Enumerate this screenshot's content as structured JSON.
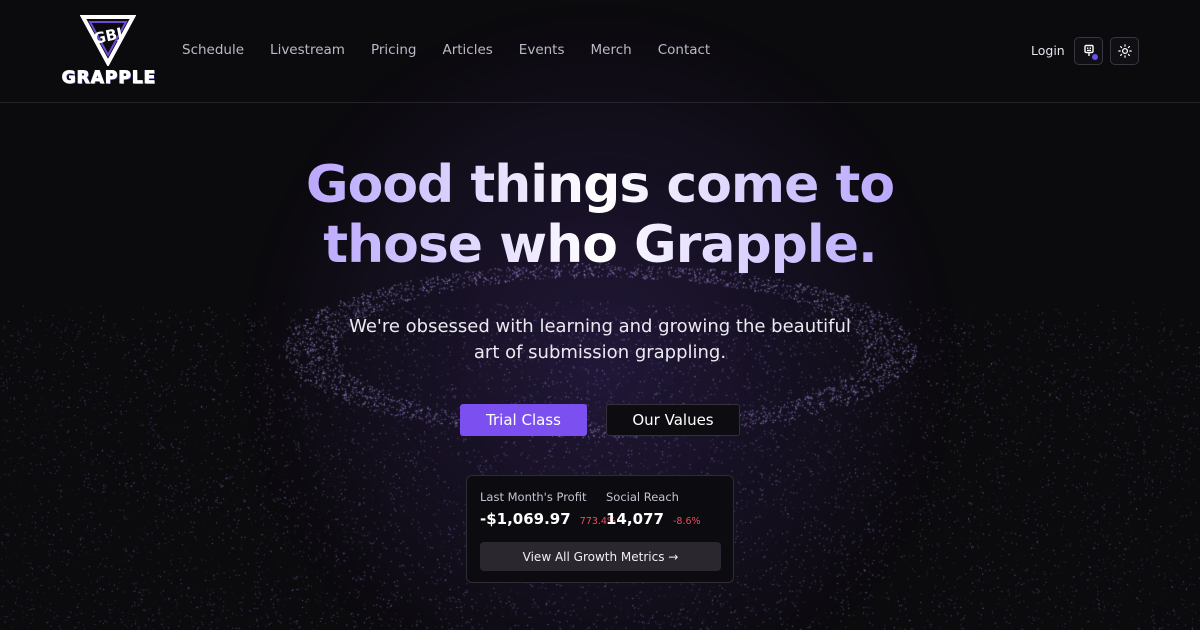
{
  "brand": {
    "logo_text": "GRAPPLE",
    "logo_mark": "triangle-gbj-icon",
    "accent": "#7c4ff0"
  },
  "nav": {
    "items": [
      "Schedule",
      "Livestream",
      "Pricing",
      "Articles",
      "Events",
      "Merch",
      "Contact"
    ],
    "login": "Login",
    "icons": [
      "keyboard-icon",
      "sun-icon"
    ]
  },
  "hero": {
    "title_line1": "Good things come to",
    "title_line2": "those who Grapple.",
    "subtitle_line1": "We're obsessed with learning and growing the beautiful",
    "subtitle_line2": "art of submission grappling.",
    "primary_button": "Trial Class",
    "secondary_button": "Our Values"
  },
  "metrics": {
    "profit_label": "Last Month's Profit",
    "profit_value": "-$1,069.97",
    "profit_change": "773.4%",
    "reach_label": "Social Reach",
    "reach_value": "14,077",
    "reach_change": "-8.6%",
    "button": "View All Growth Metrics →",
    "negative_color": "#f04b5b"
  }
}
